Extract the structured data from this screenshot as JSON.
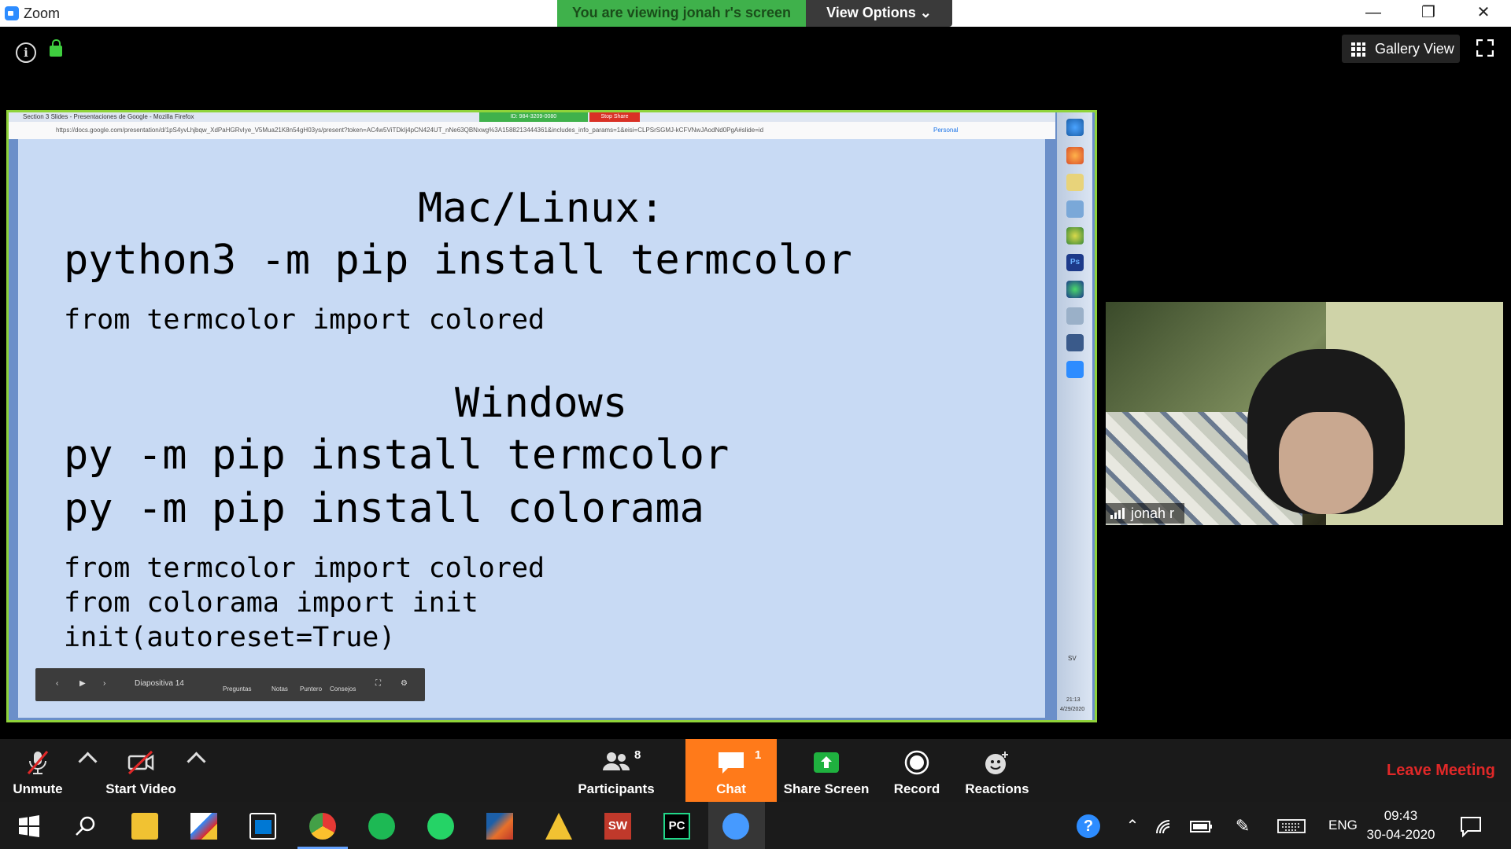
{
  "window": {
    "app_title": "Zoom",
    "minimize": "—",
    "restore": "❐",
    "close": "✕"
  },
  "share_banner": {
    "text": "You are viewing jonah r's screen",
    "options_label": "View Options ⌄"
  },
  "top_overlay": {
    "gallery_label": "Gallery View"
  },
  "shared_screen": {
    "firefox_title": "Section 3 Slides - Presentaciones de Google - Mozilla Firefox",
    "meeting_id": "ID: 984-3209-0080",
    "stop_share": "Stop Share",
    "url": "https://docs.google.com/presentation/d/1pS4yvLhjbqw_XdPaHGRvIye_V5Mua21K8n54gH03ys/present?token=AC4w5ViTDkIj4pCN424UT_nNe63QBNxwg%3A1588213444361&includes_info_params=1&eisi=CLPSrSGMJ-kCFVNwJAodNd0PgA#slide=id",
    "personal_label": "Personal",
    "slide": {
      "heading_mac": "Mac/Linux:",
      "cmd_mac": "python3 -m pip install termcolor",
      "import_mac": "from termcolor import colored",
      "heading_win": "Windows",
      "cmd_win_1": "py -m pip install termcolor",
      "cmd_win_2": "py -m pip install colorama",
      "code_1": "from termcolor import colored",
      "code_2": "from colorama import init",
      "code_3": "init(autoreset=True)"
    },
    "slide_controls": {
      "slide_label": "Diapositiva 14",
      "preguntas": "Preguntas",
      "notas": "Notas",
      "puntero": "Puntero",
      "consejos": "Consejos"
    },
    "sidebar_time": "21:13",
    "sidebar_date": "4/29/2020",
    "sidebar_lang": "SV"
  },
  "participant": {
    "name": "jonah r"
  },
  "toolbar": {
    "unmute": "Unmute",
    "start_video": "Start Video",
    "participants": "Participants",
    "participants_count": "8",
    "chat": "Chat",
    "chat_badge": "1",
    "share_screen": "Share Screen",
    "record": "Record",
    "reactions": "Reactions",
    "leave": "Leave Meeting"
  },
  "taskbar": {
    "language": "ENG",
    "time": "09:43",
    "date": "30-04-2020"
  },
  "colors": {
    "share_green": "#3fb14b",
    "chat_orange": "#ff7a1a",
    "leave_red": "#e02828",
    "slide_bg": "#c8daf4"
  }
}
